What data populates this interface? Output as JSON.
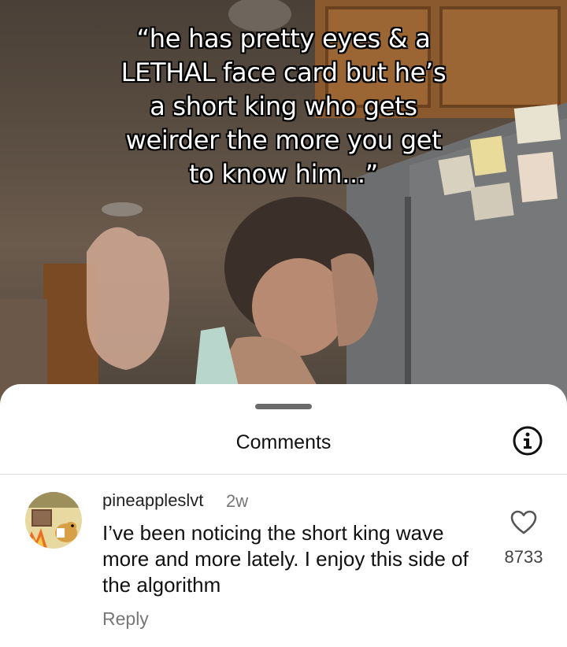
{
  "video": {
    "caption": "“he has pretty eyes & a\nLETHAL face card but he’s\na short king who gets\nweirder the more you get\nto know him...”"
  },
  "sheet": {
    "title": "Comments",
    "info_icon": "info-circle-icon",
    "handle_icon": "drag-handle"
  },
  "comments": [
    {
      "username": "pineappleslvt",
      "time": "2w",
      "text": "I’ve been noticing the short king wave more and more lately. I enjoy this side of the algorithm",
      "reply_label": "Reply",
      "like_icon": "heart-outline-icon",
      "like_count": "8733",
      "avatar_icon": "this-is-fine-dog-avatar"
    }
  ],
  "colors": {
    "sheet_bg": "#ffffff",
    "text_primary": "#111111",
    "text_secondary": "#777777",
    "caption_text": "#ffffff",
    "caption_outline": "#000000"
  }
}
